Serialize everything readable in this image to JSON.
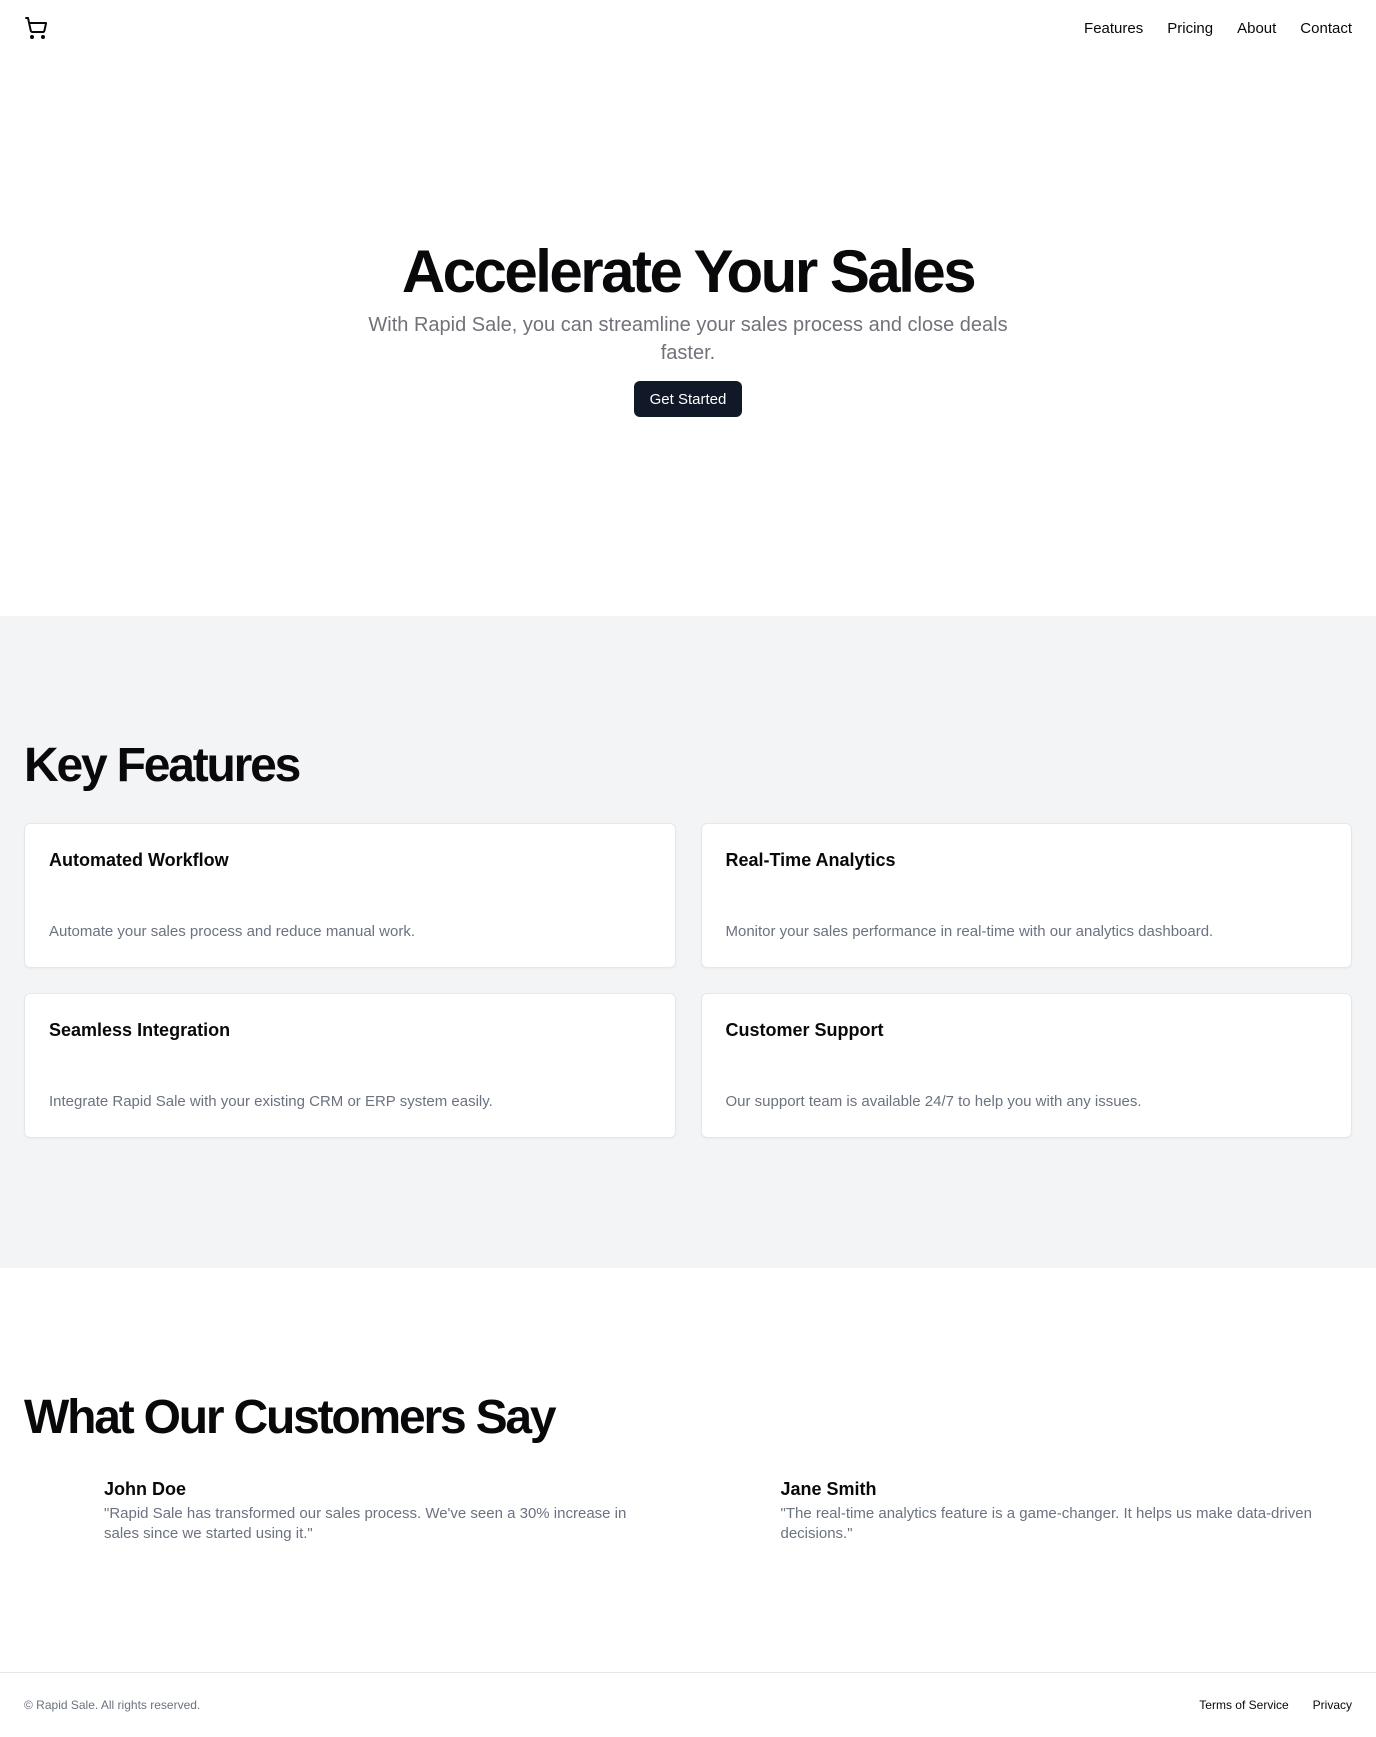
{
  "header": {
    "logo_icon": "shopping-cart-icon",
    "nav": [
      {
        "label": "Features"
      },
      {
        "label": "Pricing"
      },
      {
        "label": "About"
      },
      {
        "label": "Contact"
      }
    ]
  },
  "hero": {
    "title": "Accelerate Your Sales",
    "subtitle": "With Rapid Sale, you can streamline your sales process and close deals faster.",
    "cta_label": "Get Started"
  },
  "features": {
    "title": "Key Features",
    "items": [
      {
        "title": "Automated Workflow",
        "description": "Automate your sales process and reduce manual work."
      },
      {
        "title": "Real-Time Analytics",
        "description": "Monitor your sales performance in real-time with our analytics dashboard."
      },
      {
        "title": "Seamless Integration",
        "description": "Integrate Rapid Sale with your existing CRM or ERP system easily."
      },
      {
        "title": "Customer Support",
        "description": "Our support team is available 24/7 to help you with any issues."
      }
    ]
  },
  "testimonials": {
    "title": "What Our Customers Say",
    "items": [
      {
        "name": "John Doe",
        "quote": "\"Rapid Sale has transformed our sales process. We've seen a 30% increase in sales since we started using it.\""
      },
      {
        "name": "Jane Smith",
        "quote": "\"The real-time analytics feature is a game-changer. It helps us make data-driven decisions.\""
      }
    ]
  },
  "footer": {
    "copyright": "© Rapid Sale. All rights reserved.",
    "links": [
      {
        "label": "Terms of Service"
      },
      {
        "label": "Privacy"
      }
    ]
  },
  "colors": {
    "button_bg": "#111827",
    "section_bg": "#f3f4f6",
    "muted_text": "#6b7280"
  }
}
